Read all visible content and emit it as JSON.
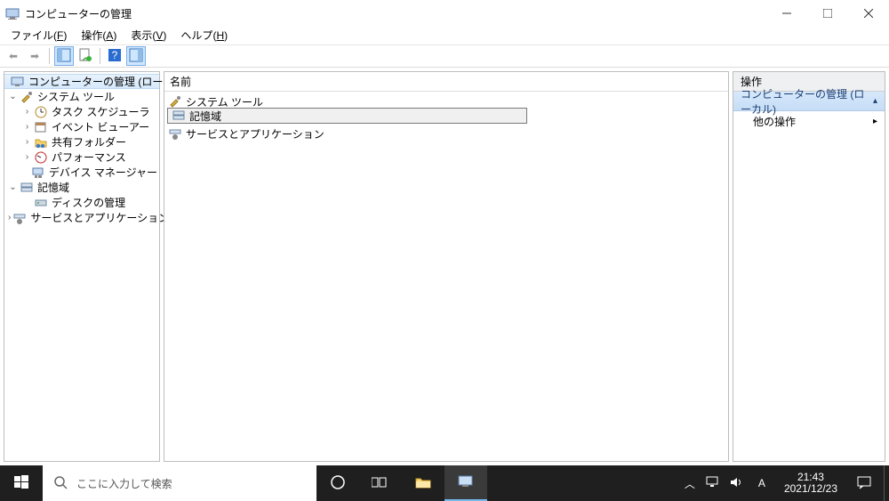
{
  "window": {
    "title": "コンピューターの管理"
  },
  "menu": {
    "file": "ファイル",
    "file_u": "F",
    "action": "操作",
    "action_u": "A",
    "view": "表示",
    "view_u": "V",
    "help": "ヘルプ",
    "help_u": "H"
  },
  "tree": {
    "root": "コンピューターの管理 (ローカル)",
    "systools": "システム ツール",
    "taskched": "タスク スケジューラ",
    "eventvwr": "イベント ビューアー",
    "shared": "共有フォルダー",
    "perf": "パフォーマンス",
    "devmgr": "デバイス マネージャー",
    "storage": "記憶域",
    "diskmgmt": "ディスクの管理",
    "svcapps": "サービスとアプリケーション"
  },
  "list": {
    "header": "名前",
    "items": {
      "systools": "システム ツール",
      "storage": "記憶域",
      "svcapps": "サービスとアプリケーション"
    }
  },
  "actions": {
    "title": "操作",
    "selected": "コンピューターの管理 (ローカル)",
    "more": "他の操作"
  },
  "taskbar": {
    "search_placeholder": "ここに入力して検索",
    "ime": "A",
    "time": "21:43",
    "date": "2021/12/23"
  }
}
